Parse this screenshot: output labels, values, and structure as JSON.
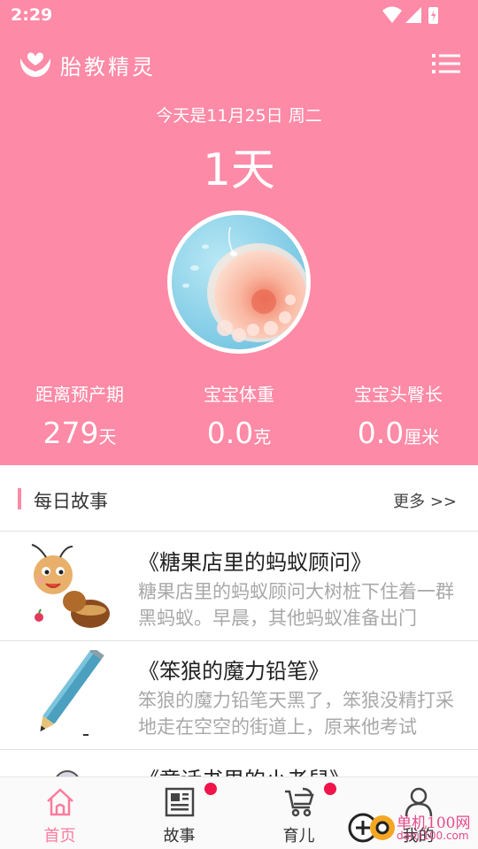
{
  "status_bar": {
    "time": "2:29"
  },
  "app": {
    "title": "胎教精灵"
  },
  "hero": {
    "date_line": "今天是11月25日 周二",
    "day_count": "1天",
    "stats": [
      {
        "label": "距离预产期",
        "value": "279",
        "unit": "天"
      },
      {
        "label": "宝宝体重",
        "value": "0.0",
        "unit": "克"
      },
      {
        "label": "宝宝头臀长",
        "value": "0.0",
        "unit": "厘米"
      }
    ]
  },
  "daily_stories": {
    "title": "每日故事",
    "more_label": "更多 >>",
    "items": [
      {
        "title": "《糖果店里的蚂蚁顾问》",
        "summary": "糖果店里的蚂蚁顾问大树桩下住着一群黑蚂蚁。早晨，其他蚂蚁准备出门"
      },
      {
        "title": "《笨狼的魔力铅笔》",
        "summary": "笨狼的魔力铅笔天黑了，笨狼没精打采地走在空空的街道上，原来他考试"
      },
      {
        "title": "《童话书里的小老鼠》",
        "summary": ""
      }
    ]
  },
  "bottom_nav": {
    "items": [
      {
        "label": "首页",
        "icon": "home-icon",
        "active": true,
        "badge": false
      },
      {
        "label": "故事",
        "icon": "newspaper-icon",
        "active": false,
        "badge": true
      },
      {
        "label": "育儿",
        "icon": "stroller-icon",
        "active": false,
        "badge": true
      },
      {
        "label": "我的",
        "icon": "person-icon",
        "active": false,
        "badge": false
      }
    ]
  },
  "watermark": {
    "line1": "单机100网",
    "line2": "danji100.com"
  },
  "colors": {
    "primary": "#fd8aa6",
    "nav_active": "#fd7b9d",
    "badge": "#f0144b"
  }
}
